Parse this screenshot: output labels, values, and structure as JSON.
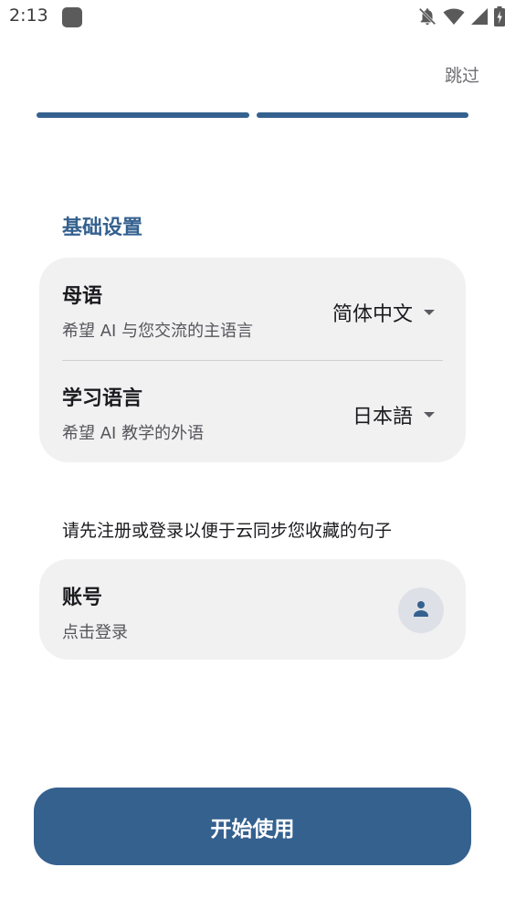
{
  "status_bar": {
    "time": "2:13",
    "icons": [
      "app-notification-icon",
      "notifications-off-icon",
      "wifi-icon",
      "signal-icon",
      "battery-icon"
    ]
  },
  "header": {
    "skip_label": "跳过"
  },
  "progress": {
    "total_steps": 2,
    "completed_steps": 2,
    "color": "#35618f"
  },
  "basic_settings": {
    "title": "基础设置",
    "native_language": {
      "title": "母语",
      "subtitle": "希望 AI 与您交流的主语言",
      "value": "简体中文"
    },
    "learning_language": {
      "title": "学习语言",
      "subtitle": "希望 AI 教学的外语",
      "value": "日本語"
    }
  },
  "account": {
    "hint": "请先注册或登录以便于云同步您收藏的句子",
    "title": "账号",
    "subtitle": "点击登录"
  },
  "start_button": {
    "label": "开始使用"
  },
  "colors": {
    "accent": "#35618f",
    "card_bg": "#f1f1f2"
  }
}
